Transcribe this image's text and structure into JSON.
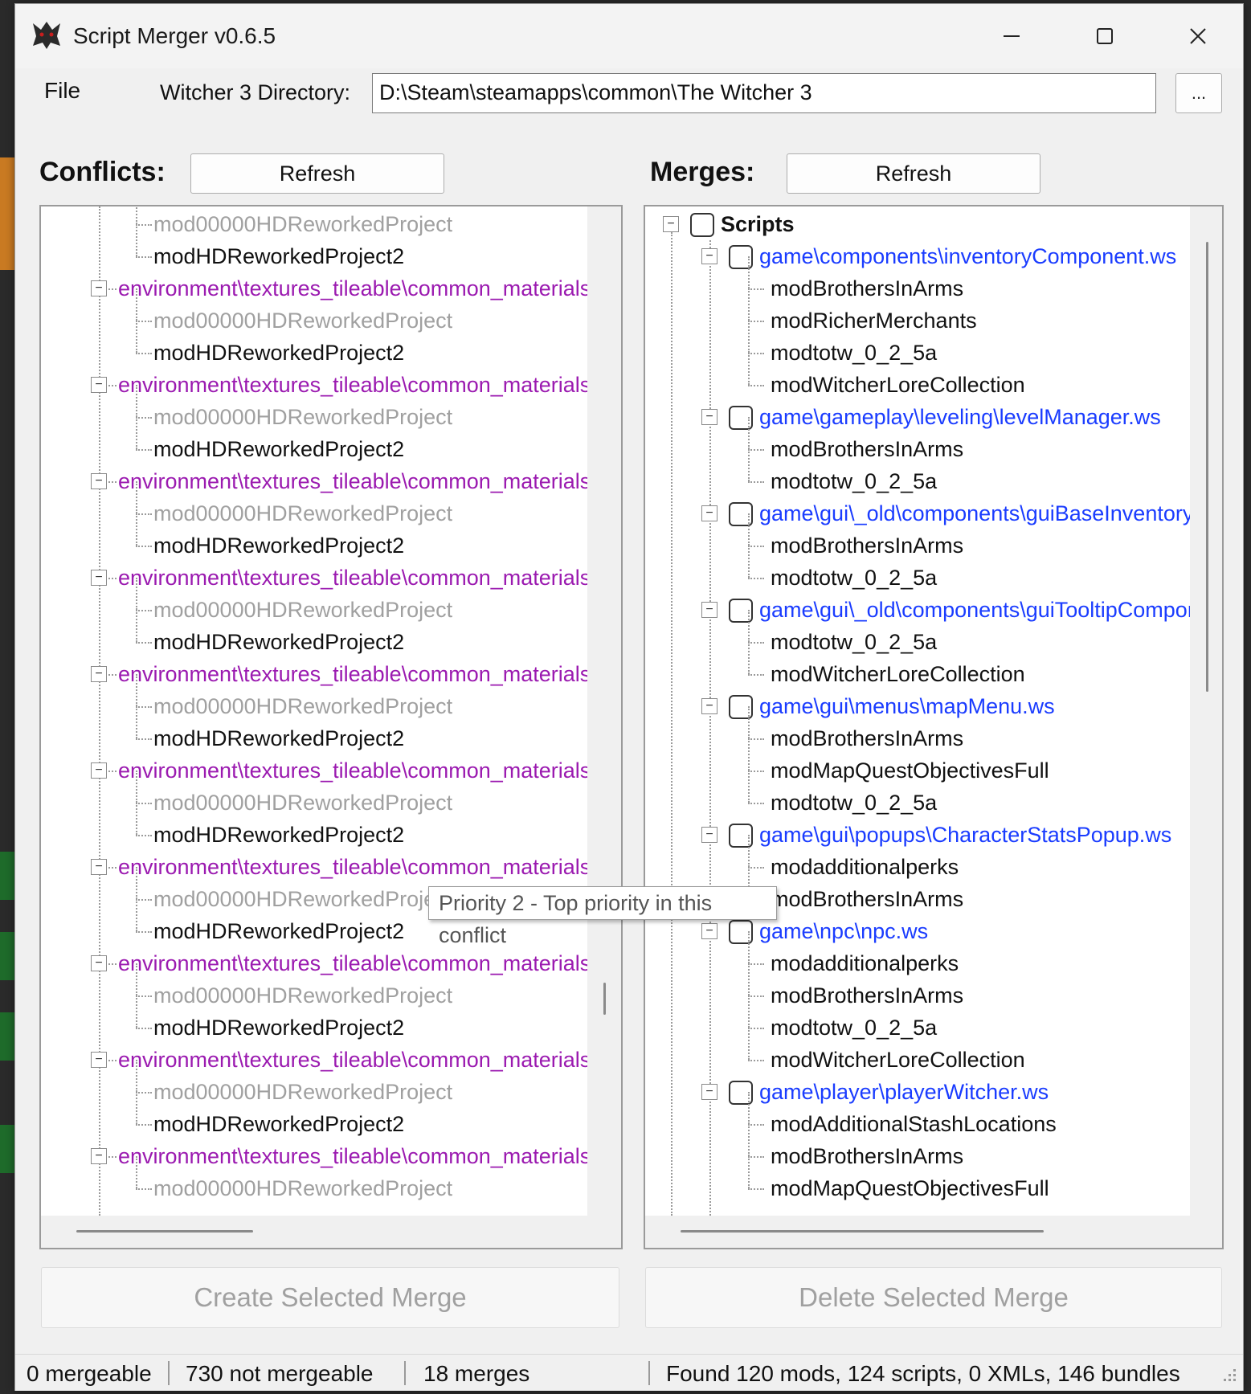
{
  "window": {
    "title": "Script Merger v0.6.5",
    "controls": {
      "minimize": "—",
      "maximize": "☐",
      "close": "✕"
    }
  },
  "menu": {
    "file": "File"
  },
  "directory": {
    "label": "Witcher 3 Directory:",
    "value": "D:\\Steam\\steamapps\\common\\The Witcher 3",
    "browse_label": "..."
  },
  "conflicts": {
    "label": "Conflicts:",
    "refresh_label": "Refresh",
    "colors": {
      "group": "#9b1ab0",
      "dim": "#a0a0a0",
      "normal": "#111111"
    },
    "rows": [
      {
        "type": "mod",
        "style": "dim",
        "text": "mod00000HDReworkedProject"
      },
      {
        "type": "mod",
        "style": "normal",
        "text": "modHDReworkedProject2"
      },
      {
        "type": "group",
        "text": "environment\\textures_tileable\\common_materials"
      },
      {
        "type": "mod",
        "style": "dim",
        "text": "mod00000HDReworkedProject"
      },
      {
        "type": "mod",
        "style": "normal",
        "text": "modHDReworkedProject2"
      },
      {
        "type": "group",
        "text": "environment\\textures_tileable\\common_materials"
      },
      {
        "type": "mod",
        "style": "dim",
        "text": "mod00000HDReworkedProject"
      },
      {
        "type": "mod",
        "style": "normal",
        "text": "modHDReworkedProject2"
      },
      {
        "type": "group",
        "text": "environment\\textures_tileable\\common_materials"
      },
      {
        "type": "mod",
        "style": "dim",
        "text": "mod00000HDReworkedProject"
      },
      {
        "type": "mod",
        "style": "normal",
        "text": "modHDReworkedProject2"
      },
      {
        "type": "group",
        "text": "environment\\textures_tileable\\common_materials"
      },
      {
        "type": "mod",
        "style": "dim",
        "text": "mod00000HDReworkedProject"
      },
      {
        "type": "mod",
        "style": "normal",
        "text": "modHDReworkedProject2"
      },
      {
        "type": "group",
        "text": "environment\\textures_tileable\\common_materials"
      },
      {
        "type": "mod",
        "style": "dim",
        "text": "mod00000HDReworkedProject"
      },
      {
        "type": "mod",
        "style": "normal",
        "text": "modHDReworkedProject2"
      },
      {
        "type": "group",
        "text": "environment\\textures_tileable\\common_materials"
      },
      {
        "type": "mod",
        "style": "dim",
        "text": "mod00000HDReworkedProject"
      },
      {
        "type": "mod",
        "style": "normal",
        "text": "modHDReworkedProject2"
      },
      {
        "type": "group",
        "text": "environment\\textures_tileable\\common_materials"
      },
      {
        "type": "mod",
        "style": "dim",
        "text": "mod00000HDReworkedProject"
      },
      {
        "type": "mod",
        "style": "normal",
        "text": "modHDReworkedProject2"
      },
      {
        "type": "group",
        "text": "environment\\textures_tileable\\common_materials"
      },
      {
        "type": "mod",
        "style": "dim",
        "text": "mod00000HDReworkedProject"
      },
      {
        "type": "mod",
        "style": "normal",
        "text": "modHDReworkedProject2"
      },
      {
        "type": "group",
        "text": "environment\\textures_tileable\\common_materials"
      },
      {
        "type": "mod",
        "style": "dim",
        "text": "mod00000HDReworkedProject"
      },
      {
        "type": "mod",
        "style": "normal",
        "text": "modHDReworkedProject2"
      },
      {
        "type": "group",
        "text": "environment\\textures_tileable\\common_materials"
      },
      {
        "type": "mod",
        "style": "dim",
        "text": "mod00000HDReworkedProject"
      }
    ]
  },
  "merges": {
    "label": "Merges:",
    "refresh_label": "Refresh",
    "colors": {
      "script": "#1a3cff",
      "normal": "#111111"
    },
    "root_label": "Scripts",
    "rows": [
      {
        "type": "script",
        "text": "game\\components\\inventoryComponent.ws"
      },
      {
        "type": "mod",
        "text": "modBrothersInArms"
      },
      {
        "type": "mod",
        "text": "modRicherMerchants"
      },
      {
        "type": "mod",
        "text": "modtotw_0_2_5a"
      },
      {
        "type": "mod",
        "text": "modWitcherLoreCollection"
      },
      {
        "type": "script",
        "text": "game\\gameplay\\leveling\\levelManager.ws"
      },
      {
        "type": "mod",
        "text": "modBrothersInArms"
      },
      {
        "type": "mod",
        "text": "modtotw_0_2_5a"
      },
      {
        "type": "script",
        "text": "game\\gui\\_old\\components\\guiBaseInventoryComponent.ws"
      },
      {
        "type": "mod",
        "text": "modBrothersInArms"
      },
      {
        "type": "mod",
        "text": "modtotw_0_2_5a"
      },
      {
        "type": "script",
        "text": "game\\gui\\_old\\components\\guiTooltipComponent.ws"
      },
      {
        "type": "mod",
        "text": "modtotw_0_2_5a"
      },
      {
        "type": "mod",
        "text": "modWitcherLoreCollection"
      },
      {
        "type": "script",
        "text": "game\\gui\\menus\\mapMenu.ws"
      },
      {
        "type": "mod",
        "text": "modBrothersInArms"
      },
      {
        "type": "mod",
        "text": "modMapQuestObjectivesFull"
      },
      {
        "type": "mod",
        "text": "modtotw_0_2_5a"
      },
      {
        "type": "script",
        "text": "game\\gui\\popups\\CharacterStatsPopup.ws"
      },
      {
        "type": "mod",
        "text": "modadditionalperks"
      },
      {
        "type": "mod",
        "text": "modBrothersInArms"
      },
      {
        "type": "script",
        "text": "game\\npc\\npc.ws"
      },
      {
        "type": "mod",
        "text": "modadditionalperks"
      },
      {
        "type": "mod",
        "text": "modBrothersInArms"
      },
      {
        "type": "mod",
        "text": "modtotw_0_2_5a"
      },
      {
        "type": "mod",
        "text": "modWitcherLoreCollection"
      },
      {
        "type": "script",
        "text": "game\\player\\playerWitcher.ws"
      },
      {
        "type": "mod",
        "text": "modAdditionalStashLocations"
      },
      {
        "type": "mod",
        "text": "modBrothersInArms"
      },
      {
        "type": "mod",
        "text": "modMapQuestObjectivesFull"
      }
    ]
  },
  "tooltip": {
    "text": "Priority 2 - Top priority in this conflict"
  },
  "actions": {
    "create": "Create Selected Merge",
    "delete": "Delete Selected Merge"
  },
  "status": {
    "mergeable": "0 mergeable",
    "not_mergeable": "730 not mergeable",
    "merges": "18 merges",
    "found": "Found 120 mods, 124 scripts, 0 XMLs, 146 bundles"
  },
  "icons": {
    "app": "wolf-medallion-icon",
    "expander": "minus-box-icon",
    "grip": "resize-grip-icon"
  }
}
